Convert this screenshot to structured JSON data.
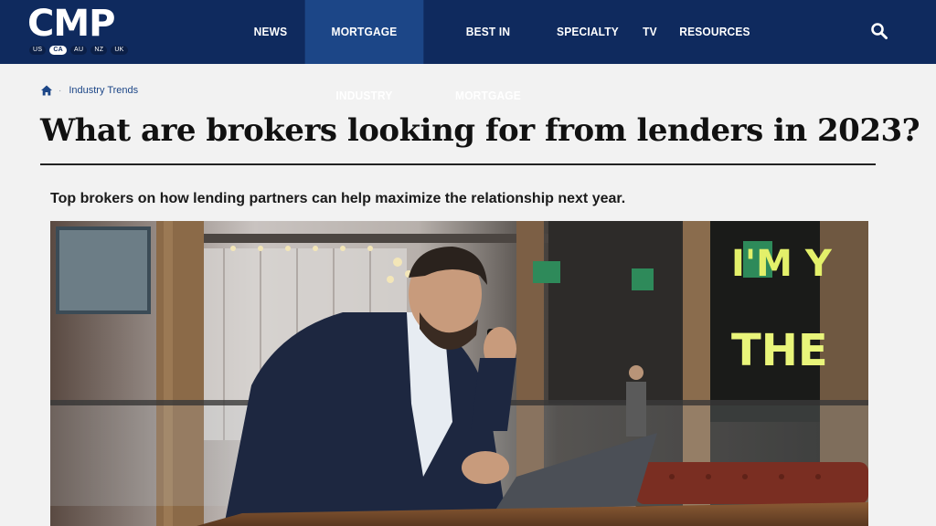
{
  "brand": {
    "logo_text": "CMP",
    "regions": [
      "US",
      "CA",
      "AU",
      "NZ",
      "UK"
    ],
    "active_region": "CA"
  },
  "nav": {
    "items": [
      "NEWS",
      "MORTGAGE INDUSTRY",
      "BEST IN MORTGAGE",
      "SPECIALTY",
      "TV",
      "RESOURCES"
    ],
    "active": "MORTGAGE INDUSTRY",
    "search_icon": "search-icon"
  },
  "breadcrumb": {
    "home_icon": "home-icon",
    "separator": "·",
    "current": "Industry Trends"
  },
  "article": {
    "title": "What are brokers looking for from lenders in 2023?",
    "subtitle": "Top brokers on how lending partners can help maximize the relationship next year."
  },
  "hero": {
    "sign_text_top": "I'M Y",
    "sign_text_bottom": "THE"
  },
  "colors": {
    "nav_bg": "#0f2a5e",
    "nav_active": "#1c4687",
    "page_bg": "#f2f2f2",
    "link": "#1c4687"
  }
}
